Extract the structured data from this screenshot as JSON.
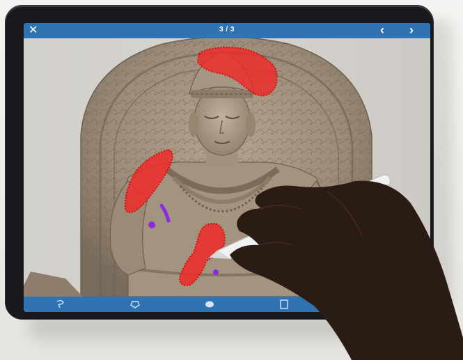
{
  "viewer": {
    "counter": "3 / 3",
    "close_icon": "close-icon",
    "prev_icon": "chevron-left-icon",
    "next_icon": "chevron-right-icon"
  },
  "annotations": {
    "highlight_color": "#f02a2a",
    "highlight_outline": "#d10d0d",
    "marker_color": "#8a2be2",
    "regions": [
      "headdress",
      "left-shoulder",
      "chest-center"
    ]
  },
  "toolbar": {
    "tools": [
      {
        "name": "lasso-icon"
      },
      {
        "name": "polygon-icon"
      },
      {
        "name": "blob-brush-icon"
      },
      {
        "name": "rectangle-icon"
      }
    ]
  },
  "colors": {
    "bar": "#2f73b3",
    "device": "#17191c"
  }
}
